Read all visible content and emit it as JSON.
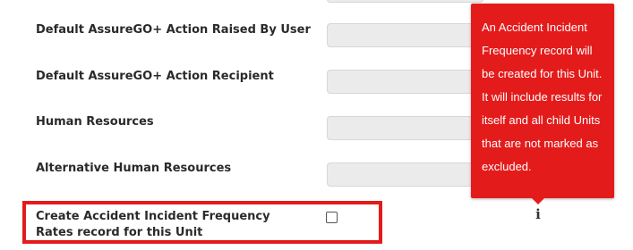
{
  "fields": [
    {
      "label": "Default AssureGO+ Action Raised By User",
      "value": ""
    },
    {
      "label": "Default AssureGO+ Action Recipient",
      "value": ""
    },
    {
      "label": "Human Resources",
      "value": ""
    },
    {
      "label": "Alternative Human Resources",
      "value": ""
    }
  ],
  "checkbox": {
    "label": "Create Accident Incident Frequency Rates record for this Unit",
    "checked": false
  },
  "tooltip": {
    "text": "An Accident Incident Frequency record will be created for this Unit. It will include results for itself and all child Units that are not marked as excluded."
  },
  "info_icon": {
    "glyph": "i",
    "icon": "info-icon"
  },
  "colors": {
    "highlight": "#e41b1b",
    "tooltip_bg": "#e41b1b",
    "input_bg": "#ebebeb"
  }
}
